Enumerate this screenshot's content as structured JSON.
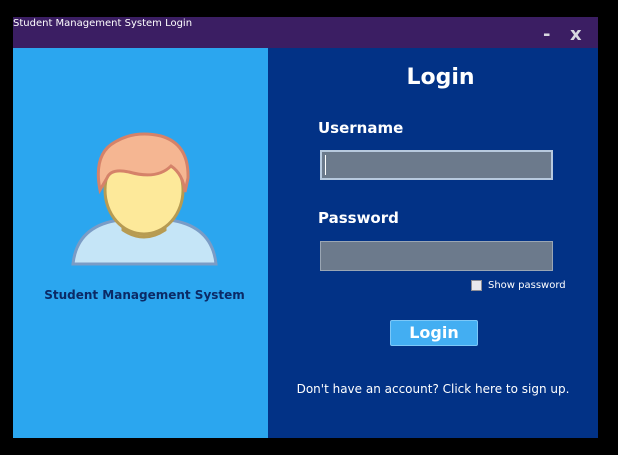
{
  "window": {
    "title": "Student Management System Login",
    "minimize_label": "-",
    "close_label": "x",
    "colors": {
      "titlebar": "#3b1e63",
      "left_panel": "#2ba6ef",
      "right_panel": "#023286"
    }
  },
  "left": {
    "avatar_icon": "user-avatar-icon",
    "system_label": "Student Management System"
  },
  "form": {
    "heading": "Login",
    "username_label": "Username",
    "username_value": "",
    "password_label": "Password",
    "password_value": "",
    "show_password_label": "Show password",
    "show_password_checked": false,
    "login_button": "Login",
    "signup_text": "Don't have an account? Click here to sign up."
  }
}
